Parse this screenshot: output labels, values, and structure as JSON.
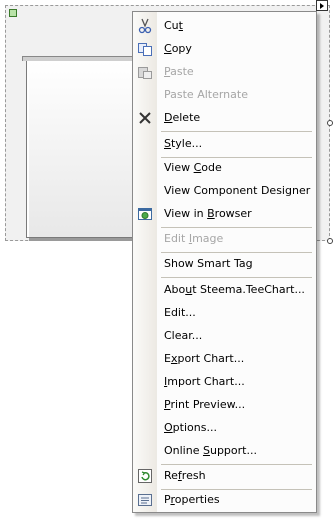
{
  "menu": {
    "items": [
      {
        "pre": "Cu",
        "acc": "t",
        "post": "",
        "icon": "cut-icon",
        "enabled": true
      },
      {
        "pre": "",
        "acc": "C",
        "post": "opy",
        "icon": "copy-icon",
        "enabled": true
      },
      {
        "pre": "",
        "acc": "P",
        "post": "aste",
        "icon": "paste-icon",
        "enabled": false
      },
      {
        "pre": "Paste Alternate",
        "acc": "",
        "post": "",
        "icon": "",
        "enabled": false
      },
      {
        "pre": "",
        "acc": "D",
        "post": "elete",
        "icon": "delete-icon",
        "enabled": true
      },
      {
        "pre": "",
        "acc": "S",
        "post": "tyle...",
        "icon": "",
        "enabled": true
      },
      {
        "pre": "View ",
        "acc": "C",
        "post": "ode",
        "icon": "",
        "enabled": true
      },
      {
        "pre": "View Component Designer",
        "acc": "",
        "post": "",
        "icon": "",
        "enabled": true
      },
      {
        "pre": "View in ",
        "acc": "B",
        "post": "rowser",
        "icon": "browser-icon",
        "enabled": true
      },
      {
        "pre": "Edit ",
        "acc": "I",
        "post": "mage",
        "icon": "",
        "enabled": false
      },
      {
        "pre": "Show Smart Tag",
        "acc": "",
        "post": "",
        "icon": "",
        "enabled": true
      },
      {
        "pre": "Abo",
        "acc": "u",
        "post": "t Steema.TeeChart...",
        "icon": "",
        "enabled": true
      },
      {
        "pre": "Edit...",
        "acc": "",
        "post": "",
        "icon": "",
        "enabled": true
      },
      {
        "pre": "Clear...",
        "acc": "",
        "post": "",
        "icon": "",
        "enabled": true
      },
      {
        "pre": "E",
        "acc": "x",
        "post": "port Chart...",
        "icon": "",
        "enabled": true
      },
      {
        "pre": "",
        "acc": "I",
        "post": "mport Chart...",
        "icon": "",
        "enabled": true
      },
      {
        "pre": "",
        "acc": "P",
        "post": "rint Preview...",
        "icon": "",
        "enabled": true
      },
      {
        "pre": "",
        "acc": "O",
        "post": "ptions...",
        "icon": "",
        "enabled": true
      },
      {
        "pre": "Online ",
        "acc": "S",
        "post": "upport...",
        "icon": "",
        "enabled": true
      },
      {
        "pre": "Re",
        "acc": "f",
        "post": "resh",
        "icon": "refresh-icon",
        "enabled": true
      },
      {
        "pre": "P",
        "acc": "r",
        "post": "operties",
        "icon": "properties-icon",
        "enabled": true
      }
    ]
  },
  "colors": {
    "menu_bg": "#fcfcfc",
    "gutter": "#ece9e3",
    "separator": "#c5c2b8",
    "disabled_text": "#a6a6a6"
  }
}
